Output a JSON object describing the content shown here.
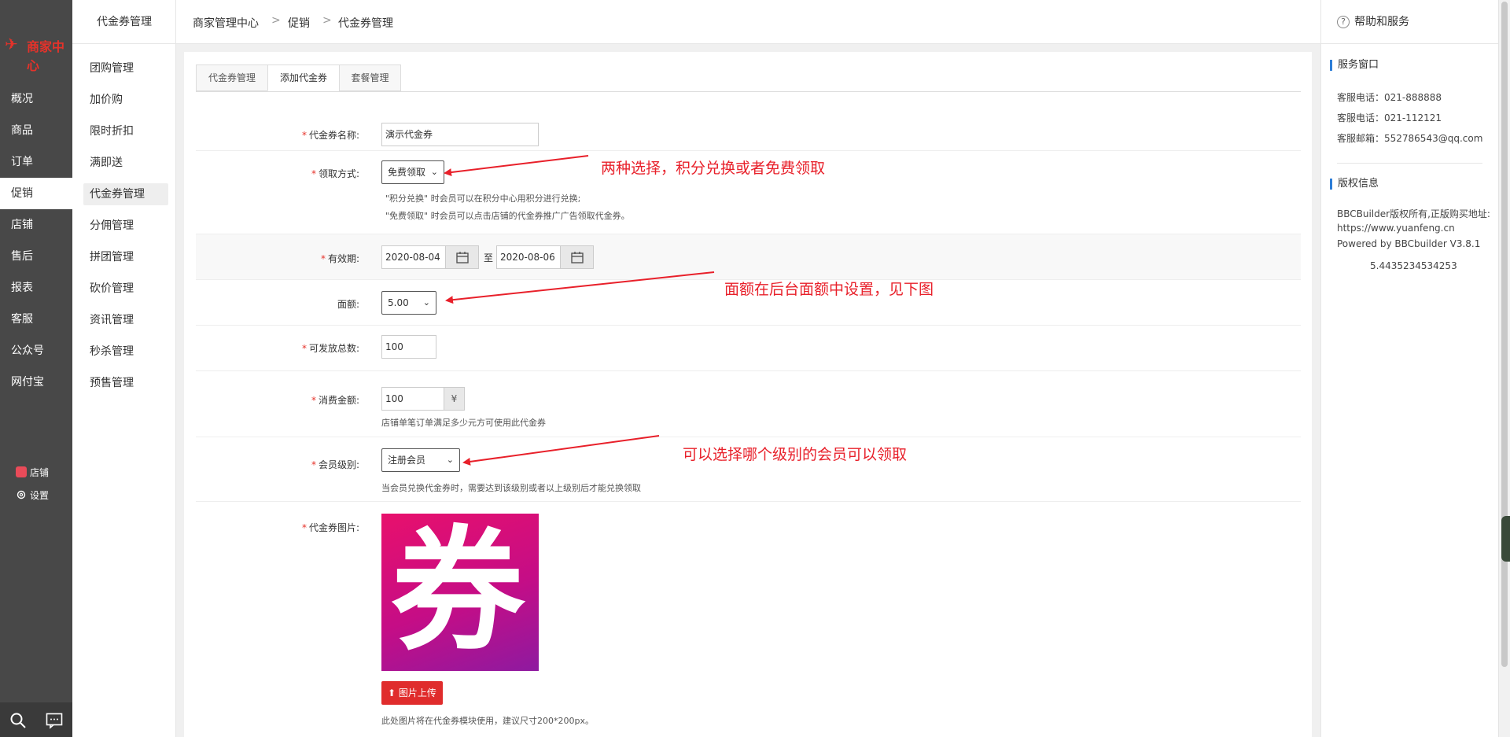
{
  "sidebar": {
    "logo_text": "商家中心",
    "items": [
      "概况",
      "商品",
      "订单",
      "促销",
      "店铺",
      "售后",
      "报表",
      "客服",
      "公众号",
      "网付宝"
    ],
    "active_index": 3,
    "links": [
      "店铺",
      "设置"
    ]
  },
  "subnav": {
    "title": "代金券管理",
    "items": [
      "团购管理",
      "加价购",
      "限时折扣",
      "满即送",
      "代金券管理",
      "分佣管理",
      "拼团管理",
      "砍价管理",
      "资讯管理",
      "秒杀管理",
      "预售管理"
    ],
    "active_index": 4
  },
  "breadcrumb": [
    "商家管理中心",
    "促销",
    "代金券管理"
  ],
  "breadcrumb_sep": ">",
  "tabs": [
    "代金券管理",
    "添加代金券",
    "套餐管理"
  ],
  "active_tab": 1,
  "form": {
    "name": {
      "label": "代金券名称:",
      "value": "演示代金券"
    },
    "method": {
      "label": "领取方式:",
      "value": "免费领取",
      "help1": "\"积分兑换\" 时会员可以在积分中心用积分进行兑换;",
      "help2": "\"免费领取\" 时会员可以点击店铺的代金券推广广告领取代金券。"
    },
    "validity": {
      "label": "有效期:",
      "start": "2020-08-04",
      "to": "至",
      "end": "2020-08-06"
    },
    "denomination": {
      "label": "面额:",
      "value": "5.00"
    },
    "total": {
      "label": "可发放总数:",
      "value": "100"
    },
    "consume": {
      "label": "消费金额:",
      "value": "100",
      "unit": "¥",
      "help": "店铺单笔订单满足多少元方可使用此代金券"
    },
    "level": {
      "label": "会员级别:",
      "value": "注册会员",
      "help": "当会员兑换代金券时，需要达到该级别或者以上级别后才能兑换领取"
    },
    "image": {
      "label": "代金券图片:",
      "glyph": "券",
      "upload_label": "图片上传",
      "help": "此处图片将在代金券模块使用，建议尺寸200*200px。"
    },
    "required_mark": "*"
  },
  "annotations": [
    "两种选择，积分兑换或者免费领取",
    "面额在后台面额中设置，见下图",
    "可以选择哪个级别的会员可以领取"
  ],
  "right_panel": {
    "title": "帮助和服务",
    "service_title": "服务窗口",
    "service_lines": [
      "客服电话：021-888888",
      "客服电话：021-112121",
      "客服邮箱：552786543@qq.com"
    ],
    "copyright_title": "版权信息",
    "copyright_lines": [
      "BBCBuilder版权所有,正版购买地址:",
      "https://www.yuanfeng.cn",
      "Powered by BBCbuilder V3.8.1",
      "5.4435234534253"
    ]
  },
  "colors": {
    "accent_red": "#e8202a",
    "sidebar_bg": "#484848",
    "section_blue": "#2d7ed8"
  }
}
